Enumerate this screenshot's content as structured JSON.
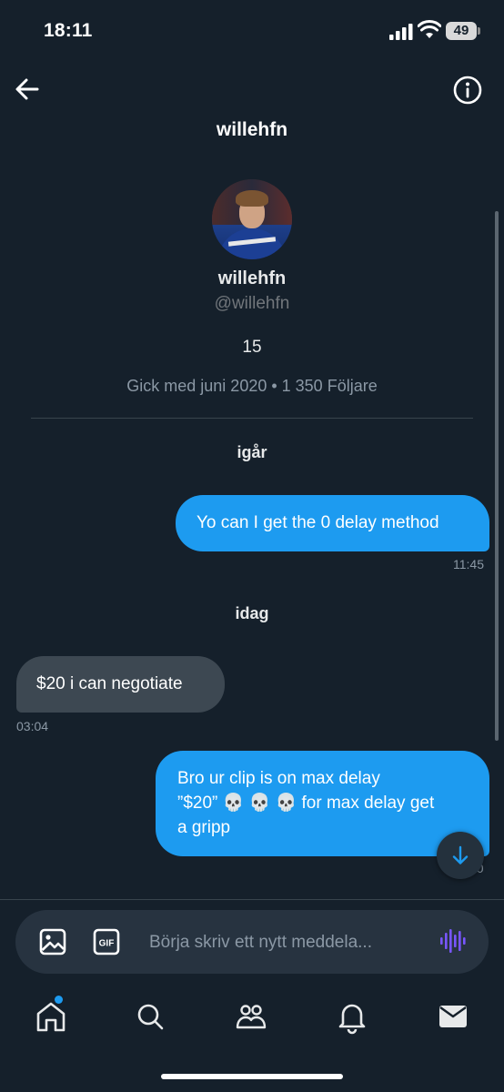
{
  "status_bar": {
    "time": "18:11",
    "battery": "49"
  },
  "header": {
    "title": "willehfn"
  },
  "profile": {
    "name": "willehfn",
    "handle": "@willehfn",
    "bio": "15",
    "meta": "Gick med juni 2020 • 1 350 Följare"
  },
  "conversation": {
    "days": [
      "igår",
      "idag"
    ],
    "messages": [
      {
        "direction": "outgoing",
        "text": "Yo can I get the 0 delay method",
        "time": "11:45"
      },
      {
        "direction": "incoming",
        "text": "$20 i can negotiate",
        "time": "03:04"
      },
      {
        "direction": "outgoing",
        "text_line1": "Bro ur clip is on max delay",
        "text_line2a": "”$20”",
        "text_line2b": "for max delay get",
        "text_line3": "a gripp",
        "time_partial": "50"
      }
    ]
  },
  "composer": {
    "placeholder": "Börja skriv ett nytt meddela..."
  },
  "icons": {
    "back": "arrow-left-icon",
    "info": "info-icon",
    "media": "image-icon",
    "gif": "gif-icon",
    "voice": "voice-wave-icon",
    "scroll": "arrow-down-icon",
    "nav": [
      "home-icon",
      "search-icon",
      "communities-icon",
      "notifications-icon",
      "messages-icon"
    ]
  },
  "colors": {
    "background": "#15202b",
    "accent": "#1d9bf0",
    "incoming_bubble": "#3d4852",
    "voice": "#7856ff"
  }
}
